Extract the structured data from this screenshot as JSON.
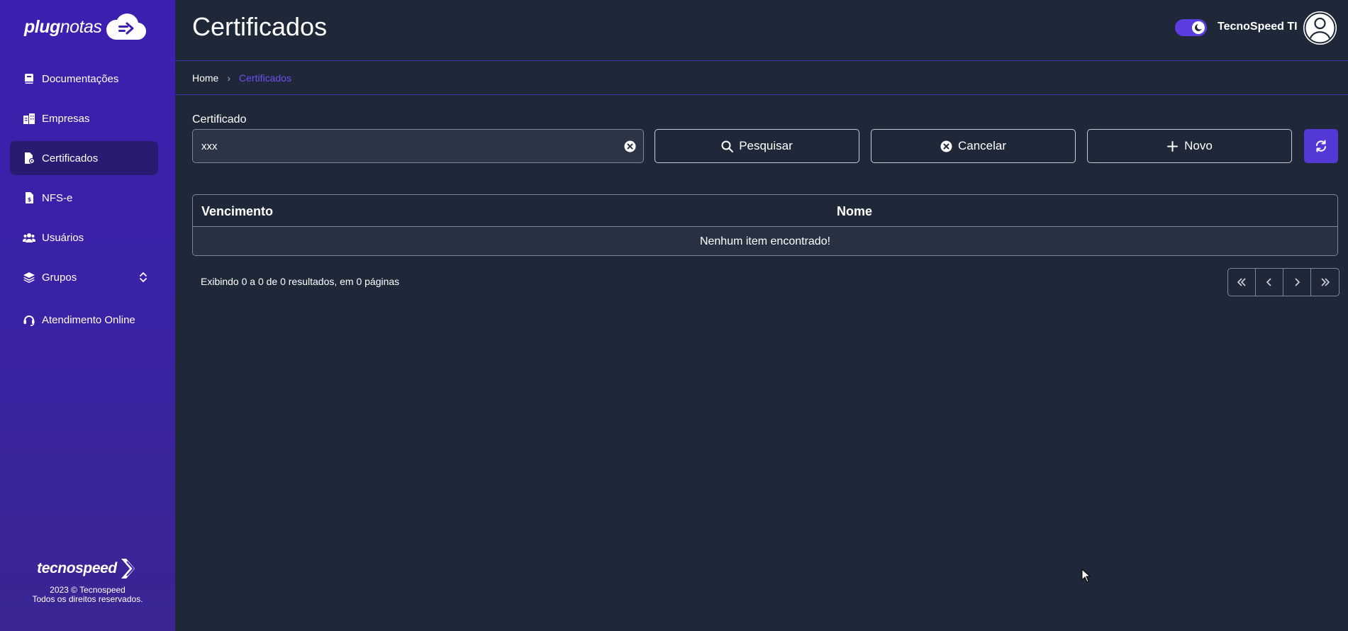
{
  "sidebar": {
    "logo_text_bold": "plug",
    "logo_text_light": "notas",
    "items": [
      {
        "label": "Documentações",
        "icon": "book-icon"
      },
      {
        "label": "Empresas",
        "icon": "buildings-icon"
      },
      {
        "label": "Certificados",
        "icon": "certificate-file-icon"
      },
      {
        "label": "NFS-e",
        "icon": "invoice-file-icon"
      },
      {
        "label": "Usuários",
        "icon": "users-icon"
      },
      {
        "label": "Grupos",
        "icon": "layers-icon"
      },
      {
        "label": "Atendimento Online",
        "icon": "headset-icon"
      }
    ],
    "active_item": "Certificados",
    "footer": {
      "brand": "tecnospeed",
      "copyright_line1": "2023 © Tecnospeed",
      "copyright_line2": "Todos os direitos reservados."
    }
  },
  "header": {
    "title": "Certificados",
    "username": "TecnoSpeed TI",
    "dark_mode": true
  },
  "breadcrumb": {
    "home": "Home",
    "current": "Certificados"
  },
  "filter": {
    "label": "Certificado",
    "value": "xxx",
    "search_label": "Pesquisar",
    "cancel_label": "Cancelar",
    "new_label": "Novo"
  },
  "table": {
    "columns": [
      "Vencimento",
      "Nome"
    ],
    "empty_message": "Nenhum item encontrado!"
  },
  "pagination": {
    "summary": "Exibindo 0 a 0 de 0 resultados, em 0 páginas"
  },
  "colors": {
    "sidebar": "#3d1fb0",
    "background": "#1f2838",
    "accent": "#5438d6",
    "link": "#6e4cf2"
  }
}
